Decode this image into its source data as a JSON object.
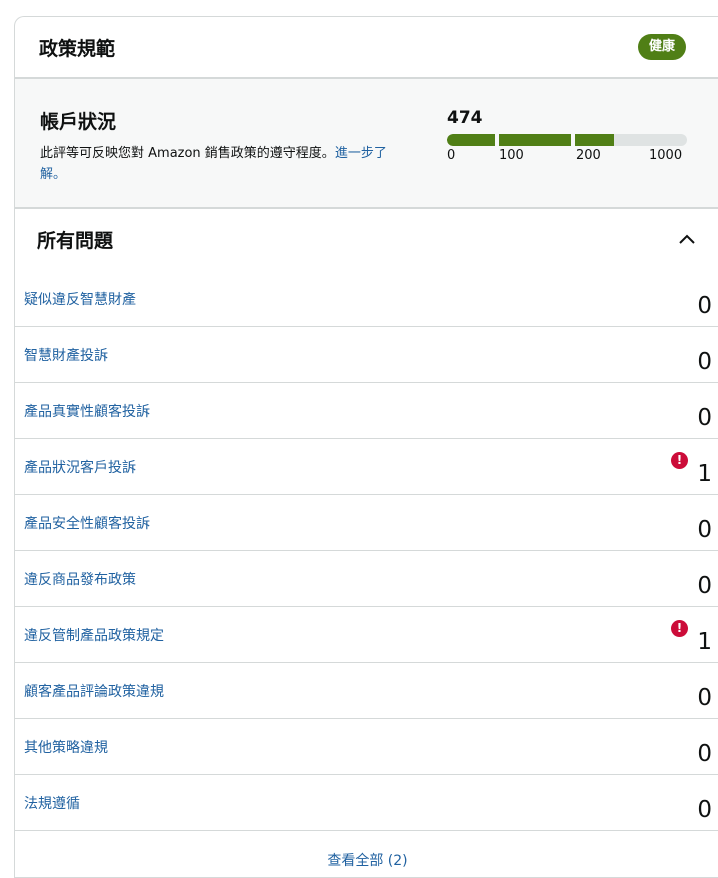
{
  "card": {
    "title": "政策規範",
    "badge": "健康"
  },
  "account_status": {
    "title": "帳戶狀況",
    "description": "此評等可反映您對 Amazon 銷售政策的遵守程度。",
    "learn_more": "進一步了解。",
    "score": "474",
    "score_fraction": 0.474,
    "scale_labels": [
      "0",
      "100",
      "200",
      "1000"
    ]
  },
  "issues": {
    "title": "所有問題",
    "items": [
      {
        "label": "疑似違反智慧財產",
        "count": "0",
        "alert": false
      },
      {
        "label": "智慧財產投訴",
        "count": "0",
        "alert": false
      },
      {
        "label": "產品真實性顧客投訴",
        "count": "0",
        "alert": false
      },
      {
        "label": "產品狀況客戶投訴",
        "count": "1",
        "alert": true
      },
      {
        "label": "產品安全性顧客投訴",
        "count": "0",
        "alert": false
      },
      {
        "label": "違反商品發布政策",
        "count": "0",
        "alert": false
      },
      {
        "label": "違反管制產品政策規定",
        "count": "1",
        "alert": true
      },
      {
        "label": "顧客產品評論政策違規",
        "count": "0",
        "alert": false
      },
      {
        "label": "其他策略違規",
        "count": "0",
        "alert": false
      },
      {
        "label": "法規遵循",
        "count": "0",
        "alert": false
      }
    ],
    "view_all": "查看全部 (2)"
  },
  "icons": {
    "collapse": "chevron-up-icon",
    "alert": "exclamation-circle-icon"
  },
  "colors": {
    "accent_green": "#507f16",
    "link_blue": "#2162a1",
    "alert_red": "#cc0c39"
  }
}
